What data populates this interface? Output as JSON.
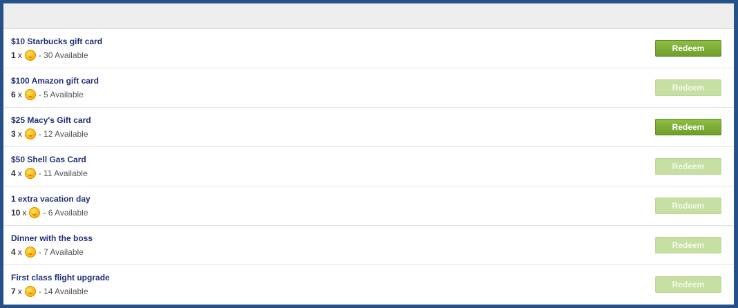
{
  "colors": {
    "frame": "#25518a",
    "title": "#1f2f78",
    "button_enabled": "#7aac33",
    "button_disabled": "#c6dfa3"
  },
  "rewards": [
    {
      "title": "$10 Starbucks gift card",
      "qty": "1",
      "x": "x",
      "available": "- 30 Available",
      "button": "Redeem",
      "enabled": true
    },
    {
      "title": "$100 Amazon gift card",
      "qty": "6",
      "x": "x",
      "available": "- 5 Available",
      "button": "Redeem",
      "enabled": false
    },
    {
      "title": "$25 Macy's Gift card",
      "qty": "3",
      "x": "x",
      "available": "- 12 Available",
      "button": "Redeem",
      "enabled": true
    },
    {
      "title": "$50 Shell Gas Card",
      "qty": "4",
      "x": "x",
      "available": "- 11 Available",
      "button": "Redeem",
      "enabled": false
    },
    {
      "title": "1 extra vacation day",
      "qty": "10",
      "x": "x",
      "available": "- 6 Available",
      "button": "Redeem",
      "enabled": false
    },
    {
      "title": "Dinner with the boss",
      "qty": "4",
      "x": "x",
      "available": "- 7 Available",
      "button": "Redeem",
      "enabled": false
    },
    {
      "title": "First class flight upgrade",
      "qty": "7",
      "x": "x",
      "available": "- 14 Available",
      "button": "Redeem",
      "enabled": false
    }
  ],
  "icons": {
    "coin": "coin-icon"
  }
}
